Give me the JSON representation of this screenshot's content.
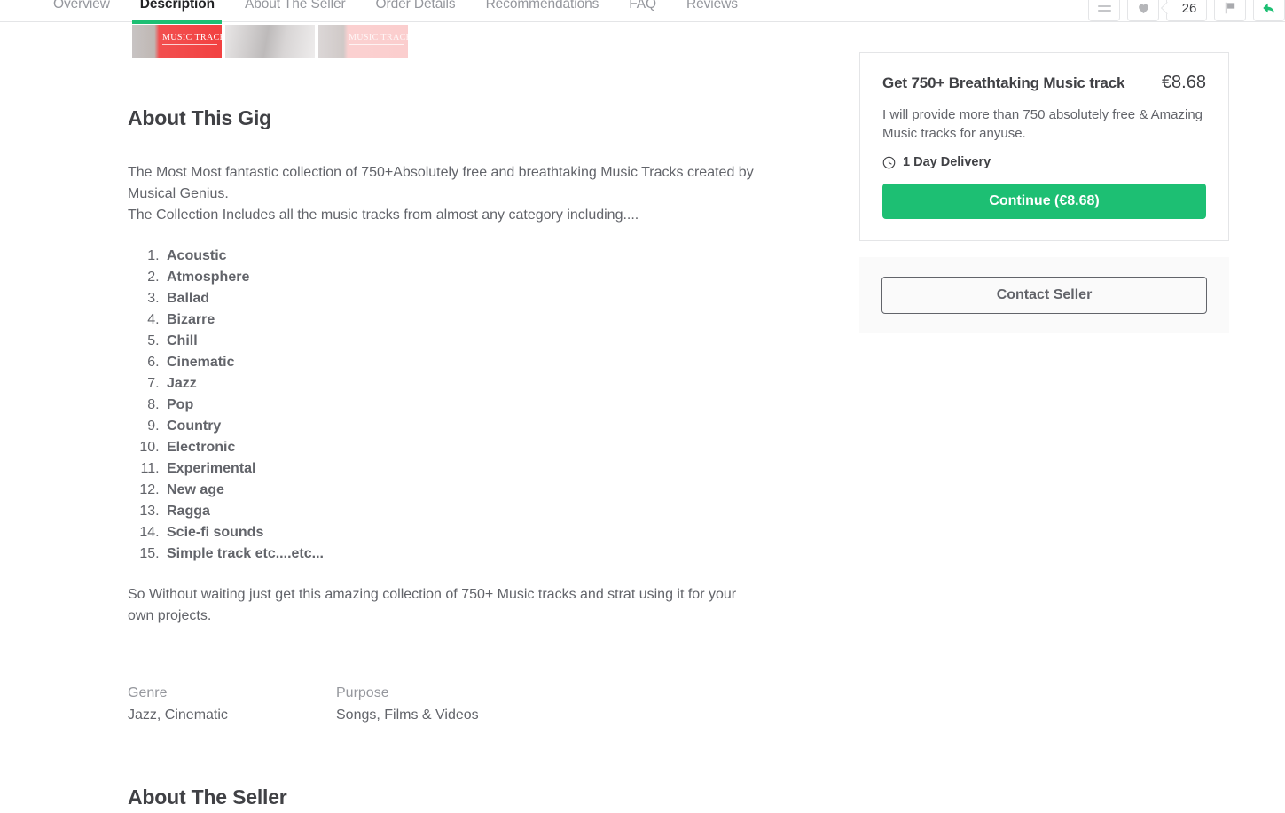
{
  "nav": {
    "tabs": [
      {
        "label": "Overview",
        "active": false
      },
      {
        "label": "Description",
        "active": true
      },
      {
        "label": "About The Seller",
        "active": false
      },
      {
        "label": "Order Details",
        "active": false
      },
      {
        "label": "Recommendations",
        "active": false
      },
      {
        "label": "FAQ",
        "active": false
      },
      {
        "label": "Reviews",
        "active": false
      }
    ],
    "actions": {
      "menu_icon": "hamburger-menu-icon",
      "favorite_icon": "heart-icon",
      "favorite_count": "26",
      "report_icon": "flag-icon",
      "share_icon": "share-arrow-icon"
    }
  },
  "gallery": {
    "thumbnails": [
      {
        "label": "Music Tracks",
        "active": true
      },
      {
        "label": "",
        "active": false
      },
      {
        "label": "Music Tracks",
        "active": false
      }
    ]
  },
  "description": {
    "heading": "About This Gig",
    "intro_line1": "The Most Most fantastic collection of 750+Absolutely free and breathtaking Music Tracks created by Musical Genius.",
    "intro_line2": "The Collection Includes all the music tracks from almost any category including....",
    "genres": [
      "Acoustic",
      "Atmosphere",
      "Ballad",
      "Bizarre",
      "Chill",
      "Cinematic",
      "Jazz",
      "Pop",
      "Country",
      "Electronic",
      "Experimental",
      "New age",
      "Ragga",
      "Scie-fi sounds",
      "Simple track etc....etc..."
    ],
    "closing": "So Without waiting just get this amazing collection of 750+ Music tracks and strat using it for your own projects.",
    "meta": {
      "genre_label": "Genre",
      "genre_value": "Jazz, Cinematic",
      "purpose_label": "Purpose",
      "purpose_value": "Songs, Films & Videos"
    }
  },
  "seller_section": {
    "heading": "About The Seller"
  },
  "sidebar": {
    "offer": {
      "name": "Get 750+ Breathtaking Music track",
      "price": "€8.68",
      "description": "I will provide more than 750 absolutely free & Amazing Music tracks for anyuse.",
      "delivery_icon": "clock-icon",
      "delivery": "1 Day Delivery",
      "continue_label": "Continue (€8.68)"
    },
    "contact": {
      "button_label": "Contact Seller"
    }
  },
  "colors": {
    "accent_green": "#1dbf73",
    "text_dark": "#404145",
    "text_muted": "#62646a",
    "text_light": "#95979d",
    "border": "#e4e5e7"
  }
}
